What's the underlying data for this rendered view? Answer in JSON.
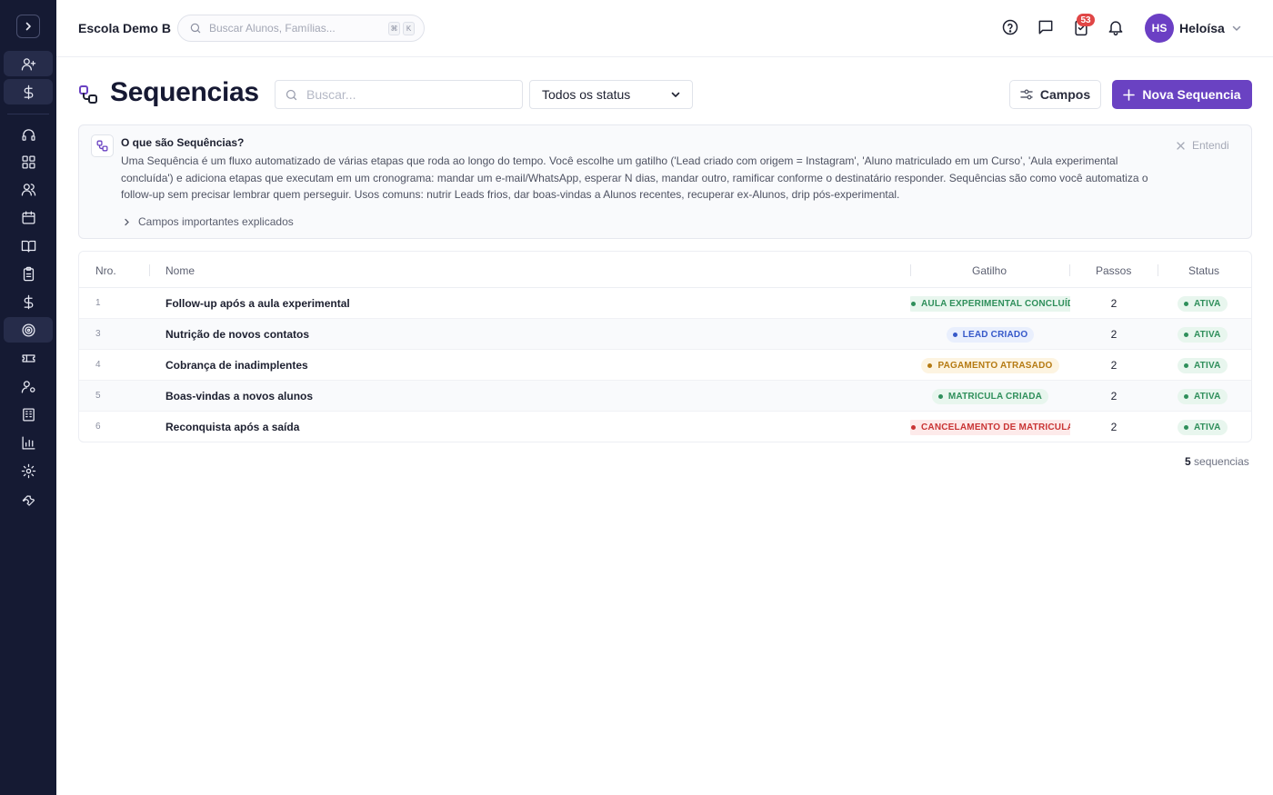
{
  "header": {
    "school": "Escola Demo B",
    "search_placeholder": "Buscar Alunos, Famílias...",
    "kbd": [
      "⌘",
      "K"
    ],
    "notifications_badge": "53",
    "user_initials": "HS",
    "user_name": "Heloísa"
  },
  "toolbar": {
    "title": "Sequencias",
    "search_placeholder": "Buscar...",
    "status_filter": "Todos os status",
    "campos_label": "Campos",
    "nova_label": "Nova Sequencia"
  },
  "info": {
    "title": "O que são Sequências?",
    "body": "Uma Sequência é um fluxo automatizado de várias etapas que roda ao longo do tempo. Você escolhe um gatilho ('Lead criado com origem = Instagram', 'Aluno matriculado em um Curso', 'Aula experimental concluída') e adiciona etapas que executam em um cronograma: mandar um e-mail/WhatsApp, esperar N dias, mandar outro, ramificar conforme o destinatário responder. Sequências são como você automatiza o follow-up sem precisar lembrar quem perseguir. Usos comuns: nutrir Leads frios, dar boas-vindas a Alunos recentes, recuperar ex-Alunos, drip pós-experimental.",
    "dismiss_label": "Entendi",
    "expander_label": "Campos importantes explicados"
  },
  "table": {
    "columns": {
      "nro": "Nro.",
      "nome": "Nome",
      "gatilho": "Gatilho",
      "passos": "Passos",
      "status": "Status"
    },
    "rows": [
      {
        "nro": "1",
        "nome": "Follow-up após a aula experimental",
        "gatilho": "AULA EXPERIMENTAL CONCLUÍDA",
        "gatilho_color": "#2f8f5b",
        "gatilho_bg": "#e8f6ee",
        "passos": "2",
        "status": "ATIVA"
      },
      {
        "nro": "3",
        "nome": "Nutrição de novos contatos",
        "gatilho": "LEAD CRIADO",
        "gatilho_color": "#3558c9",
        "gatilho_bg": "#e9effd",
        "passos": "2",
        "status": "ATIVA"
      },
      {
        "nro": "4",
        "nome": "Cobrança de inadimplentes",
        "gatilho": "PAGAMENTO ATRASADO",
        "gatilho_color": "#b57a12",
        "gatilho_bg": "#fdf4e1",
        "passos": "2",
        "status": "ATIVA"
      },
      {
        "nro": "5",
        "nome": "Boas-vindas a novos alunos",
        "gatilho": "MATRICULA CRIADA",
        "gatilho_color": "#2f8f5b",
        "gatilho_bg": "#e8f6ee",
        "passos": "2",
        "status": "ATIVA"
      },
      {
        "nro": "6",
        "nome": "Reconquista após a saída",
        "gatilho": "CANCELAMENTO DE MATRICULA",
        "gatilho_color": "#c93434",
        "gatilho_bg": "#fdeaea",
        "passos": "2",
        "status": "ATIVA"
      }
    ]
  },
  "footer": {
    "count": "5",
    "count_label": "sequencias"
  },
  "colors": {
    "accent": "#6a42c2",
    "sidebar": "#151a33",
    "status_active": "#2f8f5b"
  },
  "sidebar_icons": [
    "chevron-right-icon",
    "user-plus-icon",
    "dollar-icon",
    "headset-icon",
    "grid-icon",
    "users-icon",
    "calendar-icon",
    "book-icon",
    "clipboard-icon",
    "dollar-icon",
    "target-icon",
    "ticket-icon",
    "user-gear-icon",
    "building-icon",
    "chart-icon",
    "gear-icon",
    "wrench-icon"
  ]
}
